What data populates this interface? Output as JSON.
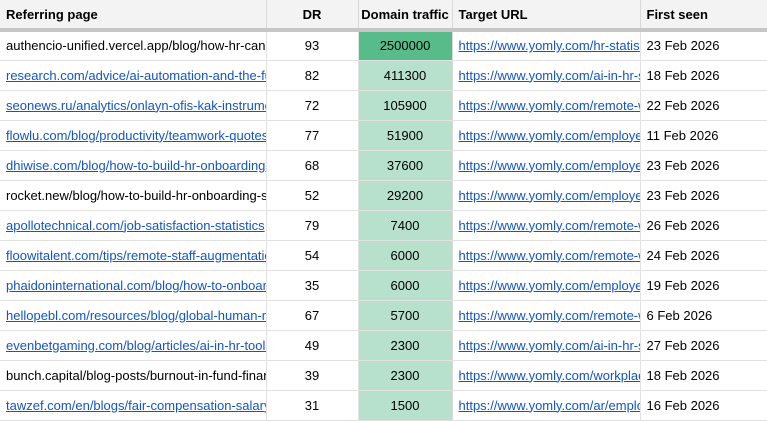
{
  "headers": {
    "referring_page": "Referring page",
    "dr": "DR",
    "domain_traffic": "Domain traffic",
    "target_url": "Target URL",
    "first_seen": "First seen"
  },
  "rows": [
    {
      "ref": "authencio-unified.vercel.app/blog/how-hr-can-drive",
      "ref_link": false,
      "dr": "93",
      "traffic": "2500000",
      "target": "https://www.yomly.com/hr-statistics/",
      "first_seen": "23 Feb 2026"
    },
    {
      "ref": "research.com/advice/ai-automation-and-the-future",
      "ref_link": true,
      "dr": "82",
      "traffic": "411300",
      "target": "https://www.yomly.com/ai-in-hr-statis",
      "first_seen": "18 Feb 2026"
    },
    {
      "ref": "seonews.ru/analytics/onlayn-ofis-kak-instrument-u",
      "ref_link": true,
      "dr": "72",
      "traffic": "105900",
      "target": "https://www.yomly.com/remote-work",
      "first_seen": "22 Feb 2026"
    },
    {
      "ref": "flowlu.com/blog/productivity/teamwork-quotes",
      "ref_link": true,
      "dr": "77",
      "traffic": "51900",
      "target": "https://www.yomly.com/employee-re",
      "first_seen": "11 Feb 2026"
    },
    {
      "ref": "dhiwise.com/blog/how-to-build-hr-onboarding-softw",
      "ref_link": true,
      "dr": "68",
      "traffic": "37600",
      "target": "https://www.yomly.com/employee-or",
      "first_seen": "23 Feb 2026"
    },
    {
      "ref": "rocket.new/blog/how-to-build-hr-onboarding-softwa",
      "ref_link": false,
      "dr": "52",
      "traffic": "29200",
      "target": "https://www.yomly.com/employee-or",
      "first_seen": "23 Feb 2026"
    },
    {
      "ref": "apollotechnical.com/job-satisfaction-statistics",
      "ref_link": true,
      "dr": "79",
      "traffic": "7400",
      "target": "https://www.yomly.com/remote-work",
      "first_seen": "26 Feb 2026"
    },
    {
      "ref": "floowitalent.com/tips/remote-staff-augmentation-se",
      "ref_link": true,
      "dr": "54",
      "traffic": "6000",
      "target": "https://www.yomly.com/remote-work",
      "first_seen": "24 Feb 2026"
    },
    {
      "ref": "phaidoninternational.com/blog/how-to-onboard-new",
      "ref_link": true,
      "dr": "35",
      "traffic": "6000",
      "target": "https://www.yomly.com/employee-or",
      "first_seen": "19 Feb 2026"
    },
    {
      "ref": "hellopebl.com/resources/blog/global-human-resour",
      "ref_link": true,
      "dr": "67",
      "traffic": "5700",
      "target": "https://www.yomly.com/remote-work",
      "first_seen": "6 Feb 2026"
    },
    {
      "ref": "evenbetgaming.com/blog/articles/ai-in-hr-tool-threa",
      "ref_link": true,
      "dr": "49",
      "traffic": "2300",
      "target": "https://www.yomly.com/ai-in-hr-statis",
      "first_seen": "27 Feb 2026"
    },
    {
      "ref": "bunch.capital/blog-posts/burnout-in-fund-finance",
      "ref_link": false,
      "dr": "39",
      "traffic": "2300",
      "target": "https://www.yomly.com/workplace-m",
      "first_seen": "18 Feb 2026"
    },
    {
      "ref": "tawzef.com/en/blogs/fair-compensation-salary-surv",
      "ref_link": true,
      "dr": "31",
      "traffic": "1500",
      "target": "https://www.yomly.com/ar/employee",
      "first_seen": "16 Feb 2026"
    }
  ],
  "colors": {
    "header_bg": "#f3f3f3",
    "traffic_top": "#57bb8a",
    "traffic_default": "#b7e1cd",
    "link": "#1155cc"
  }
}
